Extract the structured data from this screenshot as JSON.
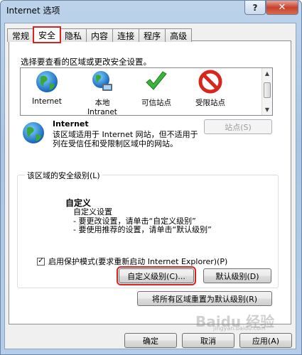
{
  "window": {
    "title": "Internet 选项",
    "help_label": "?",
    "close_label": "✕"
  },
  "tabs": [
    {
      "label": "常规"
    },
    {
      "label": "安全",
      "active": true
    },
    {
      "label": "隐私"
    },
    {
      "label": "内容"
    },
    {
      "label": "连接"
    },
    {
      "label": "程序"
    },
    {
      "label": "高级"
    }
  ],
  "zones": {
    "prompt": "选择要查看的区域或更改安全设置。",
    "items": [
      {
        "line1": "Internet",
        "line2": "",
        "icon": "globe-icon"
      },
      {
        "line1": "本地",
        "line2": "Intranet",
        "icon": "intranet-globe-icon"
      },
      {
        "line1": "可信站点",
        "line2": "",
        "icon": "checkmark-icon"
      },
      {
        "line1": "受限站点",
        "line2": "",
        "icon": "no-entry-icon"
      }
    ]
  },
  "selected_zone": {
    "name": "Internet",
    "description": "该区域适用于 Internet 网站，但不适用于列在受信任和受限制区域中的网站。",
    "sites_button": "站点(S)"
  },
  "security_level": {
    "group_label": "该区域的安全级别(L)",
    "title": "自定义",
    "lines": [
      "自定义设置",
      "- 要更改设置，请单击“自定义级别”",
      "- 要使用推荐的设置，请单击“默认级别”"
    ],
    "protected_mode_label": "启用保护模式(要求重新启动 Internet Explorer)(P)",
    "protected_mode_checked": true,
    "custom_level_button": "自定义级别(C)...",
    "default_level_button": "默认级别(D)",
    "reset_all_button": "将所有区域重置为默认级别(R)"
  },
  "footer": {
    "ok": "确定",
    "cancel": "取消",
    "apply": "应用(A)"
  },
  "watermark": {
    "text": "Baidu 经验",
    "sub": "jingyan.baidu.com"
  }
}
